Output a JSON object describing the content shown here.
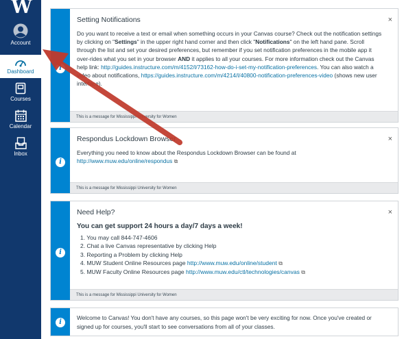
{
  "nav": {
    "logo": "W",
    "items": [
      {
        "label": "Account",
        "icon": "account-icon"
      },
      {
        "label": "Dashboard",
        "icon": "dashboard-icon",
        "active": true
      },
      {
        "label": "Courses",
        "icon": "courses-icon"
      },
      {
        "label": "Calendar",
        "icon": "calendar-icon"
      },
      {
        "label": "Inbox",
        "icon": "inbox-icon"
      }
    ]
  },
  "close_glyph": "×",
  "external_glyph": "⧉",
  "cards": [
    {
      "title": "Setting Notifications",
      "t1": "Do you want to receive a text or email when something occurs in your Canvas course?  Check out the notification settings by clicking on \"",
      "b1": "Settings",
      "t2": "\" in the upper right hand corner and then click \"",
      "b2": "Notifications",
      "t3": "\" on the left hand pane.  Scroll through the list and set your desired preferences, but remember if you set notification preferences in the mobile app it over-rides what you set in your browser ",
      "b3": "AND",
      "t4": " it applies to all your courses.  For more information check out the Canvas help link: ",
      "link1": "http://guides.instructure.com/m/4152/l/73162-how-do-i-set-my-notification-preferences",
      "t5": ".  You can also watch a video about notifications, ",
      "link2": "https://guides.instructure.com/m/4214/l/40800-notification-preferences-video",
      "t6": " (shows new user interface).",
      "footer": "This is a message for Mississippi University for Women"
    },
    {
      "title": "Respondus Lockdown Browser",
      "t1": "Everything you need to know about the Respondus Lockdown Browser can be found at ",
      "link1": "http://www.muw.edu/online/respondus",
      "footer": "This is a message for Mississippi University for Women"
    },
    {
      "title": "Need Help?",
      "headline": "You can get support 24 hours a day/7 days a week!",
      "items": [
        {
          "text": "1. You may call 844-747-4606",
          "link": ""
        },
        {
          "text": "2. Chat a live Canvas representative by clicking Help",
          "link": ""
        },
        {
          "text": "3. Reporting a Problem by clicking Help",
          "link": ""
        },
        {
          "text": "4. MUW Student Online Resources page ",
          "link": "http://www.muw.edu/online/student"
        },
        {
          "text": "5. MUW Faculty Online Resources page ",
          "link": "http://www.muw.edu/ctl/technologies/canvas"
        }
      ],
      "footer": "This is a message for Mississippi University for Women"
    },
    {
      "text": "Welcome to Canvas!  You don't have any courses, so this page won't be very exciting for now. Once you've created or signed up for courses, you'll start to see conversations from all of your classes."
    }
  ],
  "colors": {
    "nav": "#11386d",
    "accent": "#0084d1",
    "link": "#0770a3",
    "arrow": "#c0392b"
  }
}
